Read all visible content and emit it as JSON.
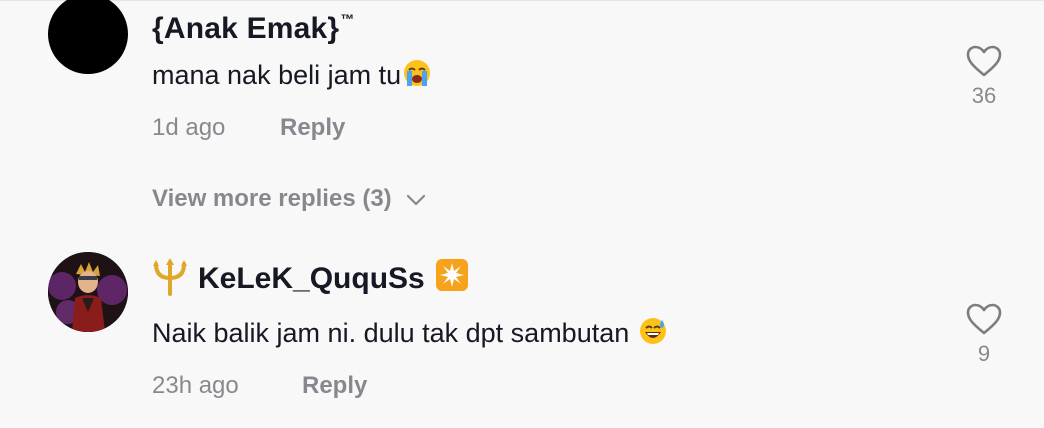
{
  "comments": [
    {
      "username": "{Anak Emak}",
      "username_suffix": "™",
      "text": "mana nak beli jam tu",
      "text_emoji": "loudly-crying-face-emoji",
      "time": "1d ago",
      "reply_label": "Reply",
      "like_count": "36",
      "avatar": "black-circle-avatar",
      "view_more": "View more replies (3)"
    },
    {
      "username": "KeLeK_QuquSs",
      "username_prefix_icon": "trident-emoji",
      "username_suffix_icon": "eight-pointed-star-emoji",
      "text": "Naik balik jam ni. dulu tak dpt sambutan ",
      "text_emoji": "grinning-face-with-sweat-emoji",
      "time": "23h ago",
      "reply_label": "Reply",
      "like_count": "9",
      "avatar": "anime-character-avatar"
    }
  ],
  "colors": {
    "background": "#f8f8f8",
    "primary_text": "#161823",
    "secondary_text": "rgba(22,24,35,0.5)",
    "sparkle_orange": "#f7a21b",
    "trident_gold": "#e0a828"
  }
}
